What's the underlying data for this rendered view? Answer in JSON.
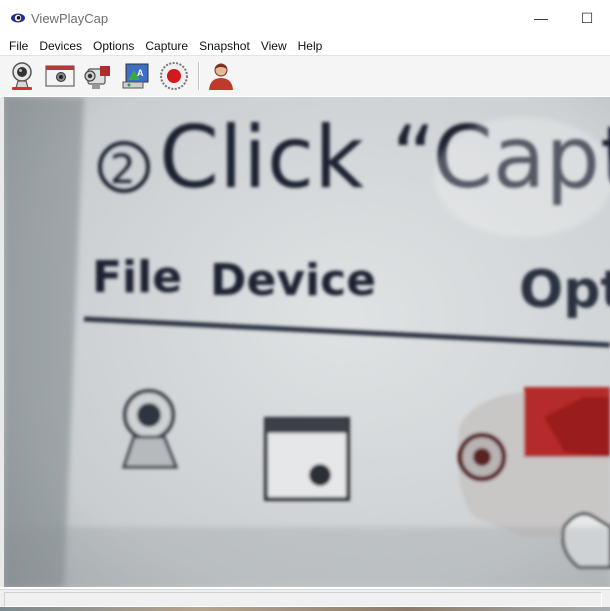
{
  "window": {
    "title": "ViewPlayCap",
    "minimize_glyph": "—",
    "maximize_glyph": "☐"
  },
  "menu": [
    "File",
    "Devices",
    "Options",
    "Capture",
    "Snapshot",
    "View",
    "Help"
  ],
  "toolbar": {
    "buttons": [
      {
        "icon": "webcam-icon"
      },
      {
        "icon": "video-window-icon"
      },
      {
        "icon": "camcorder-icon"
      },
      {
        "icon": "capture-screen-icon"
      },
      {
        "icon": "record-icon"
      },
      {
        "icon": "user-icon"
      }
    ]
  },
  "video": {
    "step_number": "2",
    "headline": "Click “Capt",
    "menu_words": [
      "File",
      "Device",
      "Opt"
    ]
  },
  "colors": {
    "record": "#d11a1a",
    "user": "#c0392b",
    "camcorder": "#b52a2a"
  }
}
